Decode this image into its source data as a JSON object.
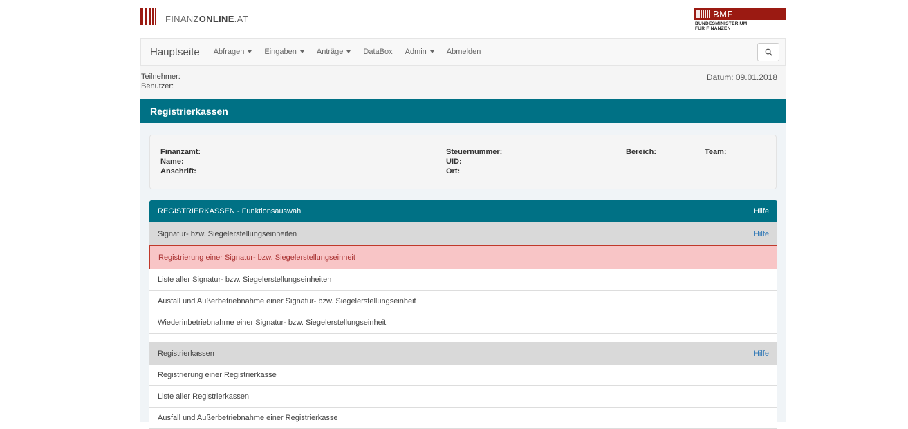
{
  "brand": {
    "logo_text_plain": "FINANZ",
    "logo_text_bold": "ONLINE",
    "logo_text_suffix": ".AT",
    "bmf_abbr": "BMF",
    "bmf_line1": "BUNDESMINISTERIUM",
    "bmf_line2": "FÜR FINANZEN",
    "accent_color": "#007185",
    "brand_red": "#9b1a12"
  },
  "nav": {
    "home": "Hauptseite",
    "items": [
      {
        "label": "Abfragen",
        "dropdown": true
      },
      {
        "label": "Eingaben",
        "dropdown": true
      },
      {
        "label": "Anträge",
        "dropdown": true
      },
      {
        "label": "DataBox",
        "dropdown": false
      },
      {
        "label": "Admin",
        "dropdown": true
      },
      {
        "label": "Abmelden",
        "dropdown": false
      }
    ],
    "search_icon": "search-icon"
  },
  "info": {
    "teilnehmer_label": "Teilnehmer:",
    "benutzer_label": "Benutzer:",
    "datum": "Datum: 09.01.2018"
  },
  "page_title": "Registrierkassen",
  "fields": {
    "finanzamt": "Finanzamt:",
    "name": "Name:",
    "anschrift": "Anschrift:",
    "steuernummer": "Steuernummer:",
    "uid": "UID:",
    "ort": "Ort:",
    "bereich": "Bereich:",
    "team": "Team:"
  },
  "panel": {
    "title": "REGISTRIERKASSEN - Funktionsauswahl",
    "help": "Hilfe",
    "sections": [
      {
        "title": "Signatur- bzw. Siegelerstellungseinheiten",
        "help": "Hilfe",
        "items": [
          "Registrierung einer Signatur- bzw. Siegelerstellungseinheit",
          "Liste aller Signatur- bzw. Siegelerstellungseinheiten",
          "Ausfall und Außerbetriebnahme einer Signatur- bzw. Siegelerstellungseinheit",
          "Wiederinbetriebnahme einer Signatur- bzw. Siegelerstellungseinheit"
        ]
      },
      {
        "title": "Registrierkassen",
        "help": "Hilfe",
        "items": [
          "Registrierung einer Registrierkasse",
          "Liste aller Registrierkassen",
          "Ausfall und Außerbetriebnahme einer Registrierkasse"
        ]
      }
    ]
  }
}
